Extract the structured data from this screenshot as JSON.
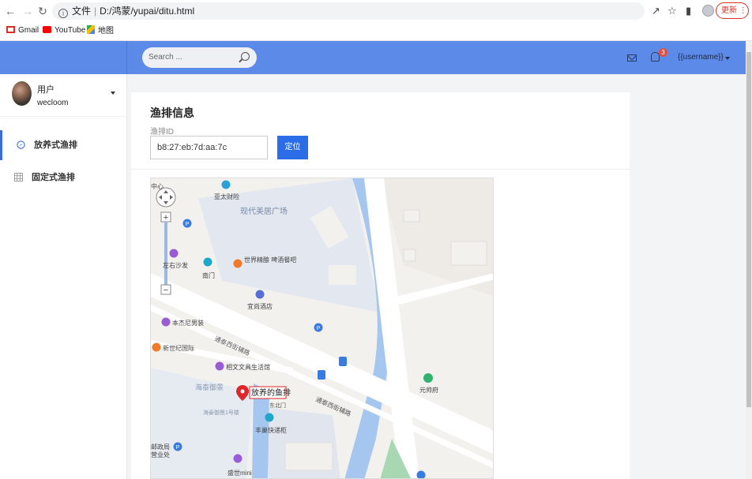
{
  "browser": {
    "address_prefix": "文件",
    "address_path": "D:/鸿蒙/yupai/ditu.html",
    "update_label": "更新",
    "bookmarks": [
      {
        "label": "Gmail",
        "icon": "gmail-icon"
      },
      {
        "label": "YouTube",
        "icon": "youtube-icon"
      },
      {
        "label": "地图",
        "icon": "maps-icon"
      }
    ]
  },
  "header": {
    "search_placeholder": "Search ...",
    "notification_count": "3",
    "username": "{{username}}",
    "accent_color": "#5b8ae8"
  },
  "sidebar": {
    "user_title": "用户",
    "user_name": "wecloom",
    "items": [
      {
        "label": "放养式渔排",
        "icon": "compass-icon",
        "active": true
      },
      {
        "label": "固定式渔排",
        "icon": "grid-icon",
        "active": false
      }
    ]
  },
  "main": {
    "title": "渔排信息",
    "field_label": "渔排ID",
    "id_value": "b8:27:eb:7d:aa:7c",
    "locate_button": "定位"
  },
  "map": {
    "labels": {
      "plaza": "现代美居广场",
      "finance": "亚太财险",
      "sofa": "左右沙发",
      "south_gate": "南门",
      "bar": "世界精酿\n啤酒餐吧",
      "hotel": "宜尚酒店",
      "menswear": "本杰尼男装",
      "road": "通泰西街辅路",
      "road2": "通泰西街辅路",
      "century": "新世纪国际",
      "stationery": "相文文具生活馆",
      "garden": "海泰御景",
      "building1": "海泰御景1号楼",
      "east_north": "东北门",
      "express": "丰巢快递柜",
      "marker": "放养的鱼排",
      "yuanshuai": "元帅府",
      "post": "邮政局",
      "post2": "营业处",
      "shengshi": "盛世mini",
      "top_left": "中心"
    }
  }
}
